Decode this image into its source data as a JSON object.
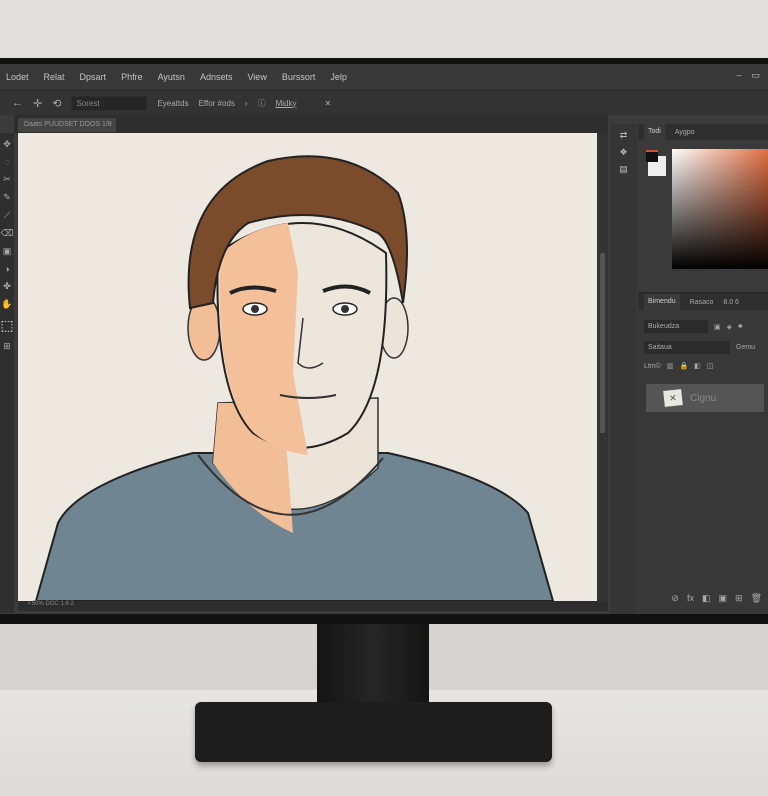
{
  "menu": [
    "Lodet",
    "Relat",
    "Dpsart",
    "Phfre",
    "Ayutsn",
    "Adnsets",
    "View",
    "Burssort",
    "Jelp"
  ],
  "window_controls": [
    "–",
    "▭"
  ],
  "options": {
    "back": "←",
    "move": "✛",
    "rotate": "⟲",
    "field_value": "Sorest",
    "label1": "Eyeattds",
    "label2": "Effor #ods",
    "arrow": "›",
    "info": "ⓘ",
    "label3": "Midky",
    "close": "✕"
  },
  "document_tab": "Daats  PUUDSET DOOS  1/8",
  "tools": [
    "✥",
    "◌",
    "✂",
    "✎",
    "⟋",
    "⌫",
    "▣",
    "◑",
    "✤",
    "✋",
    "⬚",
    "⊞"
  ],
  "status_text": "▪ 50%  DOC  1.6  2",
  "icon_strip": [
    "⇄",
    "❖",
    "▤"
  ],
  "color_panel": {
    "tabs": [
      "Todi",
      "Aygpo"
    ]
  },
  "layers_panel": {
    "tabs": [
      "Bimendu",
      "Rasaco",
      "8.0 6"
    ],
    "kind_field": "Bukeudza",
    "filter_field": "Saitaua",
    "opacity_label": "Gemu",
    "lock_label": "Ltm©",
    "layer_name": "Cignu",
    "footer_icons": [
      "⊘",
      "fx",
      "◧",
      "▣",
      "⊞",
      "🗑"
    ]
  },
  "colors": {
    "accent": "#e0683a",
    "shirt": "#6f8591",
    "hair": "#7a4c2c",
    "skin": "#f4c4a0",
    "canvas": "#ede9e1"
  }
}
